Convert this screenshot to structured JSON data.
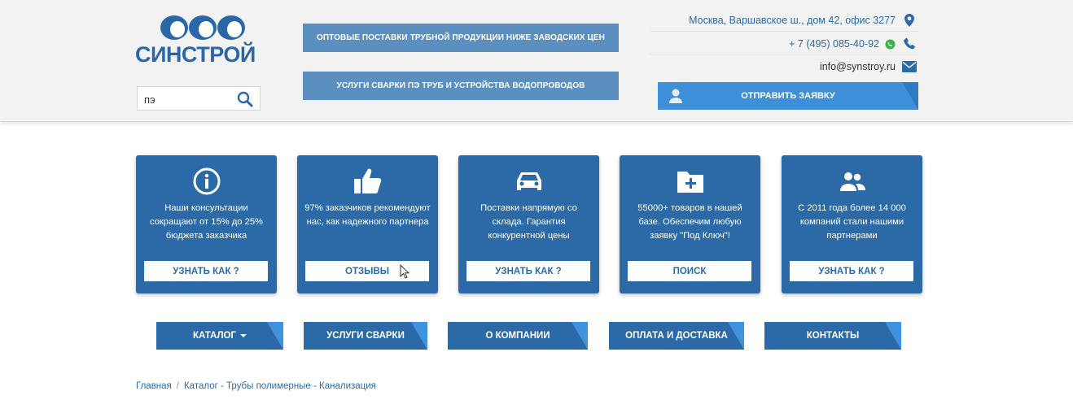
{
  "header": {
    "logo_text": "СИНСТРОЙ",
    "search": {
      "value": "пэ",
      "placeholder": ""
    },
    "promo1": "ОПТОВЫЕ ПОСТАВКИ ТРУБНОЙ ПРОДУКЦИИ НИЖЕ ЗАВОДСКИХ ЦЕН",
    "promo2": "УСЛУГИ СВАРКИ ПЭ ТРУБ И УСТРОЙСТВА ВОДОПРОВОДОВ",
    "address": "Москва, Варшавское ш., дом 42, офис 3277",
    "phone": "+ 7 (495) 085-40-92",
    "email": "info@synstroy.ru",
    "send_button": "ОТПРАВИТЬ ЗАЯВКУ",
    "icons": [
      "map-pin-icon",
      "whatsapp-icon",
      "phone-icon",
      "mail-icon",
      "user-icon",
      "search-icon"
    ]
  },
  "cards": [
    {
      "icon": "info-icon",
      "text": "Наши консультации сокращают от 15% до 25% бюджета заказчика",
      "button": "УЗНАТЬ КАК ?"
    },
    {
      "icon": "thumbs-up-icon",
      "text": "97% заказчиков рекомендуют нас, как надежного партнера",
      "button": "ОТЗЫВЫ"
    },
    {
      "icon": "car-icon",
      "text": "Поставки напрямую со склада. Гарантия конкурентной цены",
      "button": "УЗНАТЬ КАК ?"
    },
    {
      "icon": "folder-plus-icon",
      "text": "55000+ товаров в нашей базе. Обеспечим любую заявку \"Под Ключ\"!",
      "button": "ПОИСК"
    },
    {
      "icon": "users-icon",
      "text": "С 2011 года более 14 000 компаний стали нашими партнерами",
      "button": "УЗНАТЬ КАК ?"
    }
  ],
  "nav": {
    "catalog": "КАТАЛОГ",
    "welding": "УСЛУГИ СВАРКИ",
    "about": "О КОМПАНИИ",
    "payment": "ОПЛАТА И ДОСТАВКА",
    "contacts": "КОНТАКТЫ"
  },
  "breadcrumb": {
    "home": "Главная",
    "separator": "/",
    "current": "Каталог - Трубы полимерные - Канализация"
  },
  "colors": {
    "primary": "#2b6aa6",
    "accent": "#3d8fd9",
    "promo": "#5a8fbf",
    "header_bg": "#f2f2f2"
  }
}
